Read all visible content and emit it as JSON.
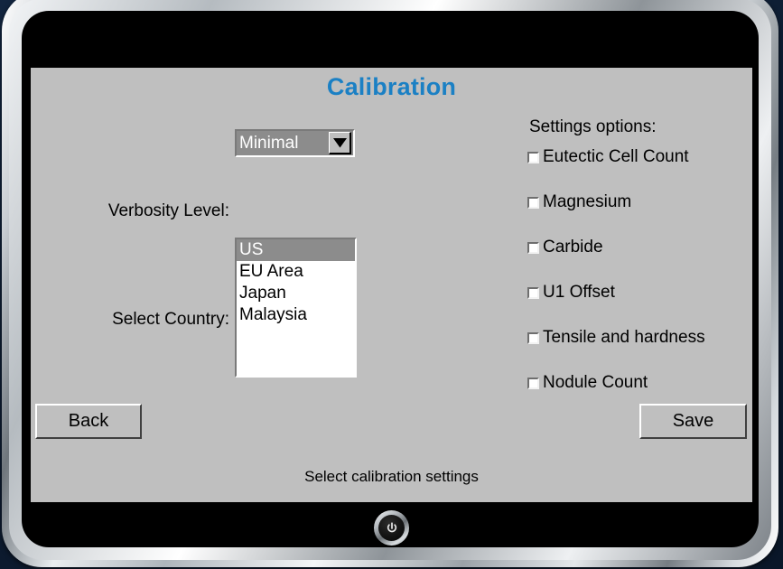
{
  "app": {
    "title": "Calibration",
    "title_color": "#1b80c4",
    "panel_bg": "#bfbfbf",
    "status_text": "Select calibration settings"
  },
  "verbosity": {
    "label": "Verbosity Level:",
    "selected": "Minimal",
    "arrow_icon": "chevron-down-icon"
  },
  "country": {
    "label": "Select Country:",
    "selected": "US",
    "items": [
      {
        "label": "US",
        "selected": true
      },
      {
        "label": "EU Area",
        "selected": false
      },
      {
        "label": "Japan",
        "selected": false
      },
      {
        "label": "Malaysia",
        "selected": false
      }
    ]
  },
  "settings": {
    "heading": "Settings options:",
    "options": [
      {
        "label": "Eutectic Cell Count",
        "checked": false
      },
      {
        "label": "Magnesium",
        "checked": false
      },
      {
        "label": "Carbide",
        "checked": false
      },
      {
        "label": "U1 Offset",
        "checked": false
      },
      {
        "label": "Tensile and hardness",
        "checked": false
      },
      {
        "label": "Nodule Count",
        "checked": false
      }
    ]
  },
  "buttons": {
    "back_label": "Back",
    "save_label": "Save"
  },
  "device": {
    "power_icon": "power-icon"
  }
}
